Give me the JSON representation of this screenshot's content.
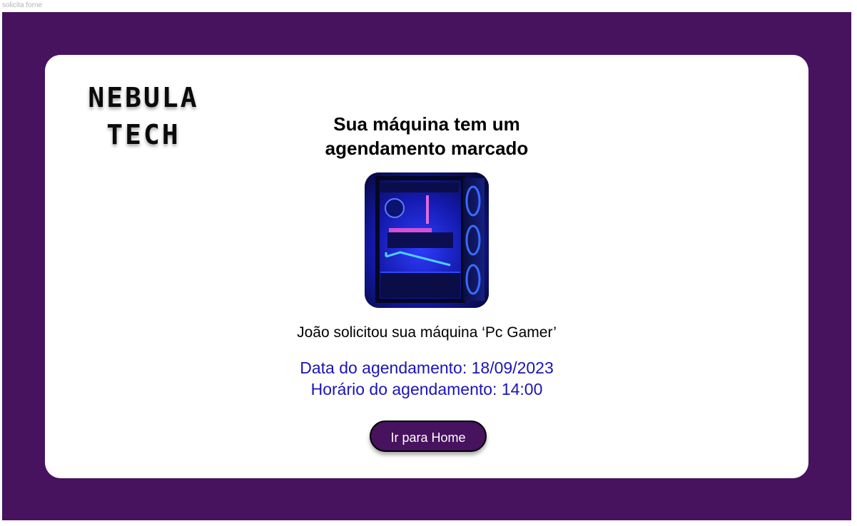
{
  "frame": {
    "label": "solicita forne"
  },
  "logo": {
    "line1": "NEBULA",
    "line2": "TECH"
  },
  "main": {
    "title": "Sua máquina tem um agendamento marcado",
    "image_icon": "gaming-pc-photo",
    "request_text": "João solicitou sua máquina ‘Pc Gamer’",
    "schedule_date": "Data do agendamento: 18/09/2023",
    "schedule_time": "Horário do agendamento: 14:00",
    "home_button_label": "Ir para Home"
  },
  "colors": {
    "background": "#47125e",
    "card": "#ffffff",
    "button": "#47125e",
    "schedule_text": "#1a14b8"
  }
}
